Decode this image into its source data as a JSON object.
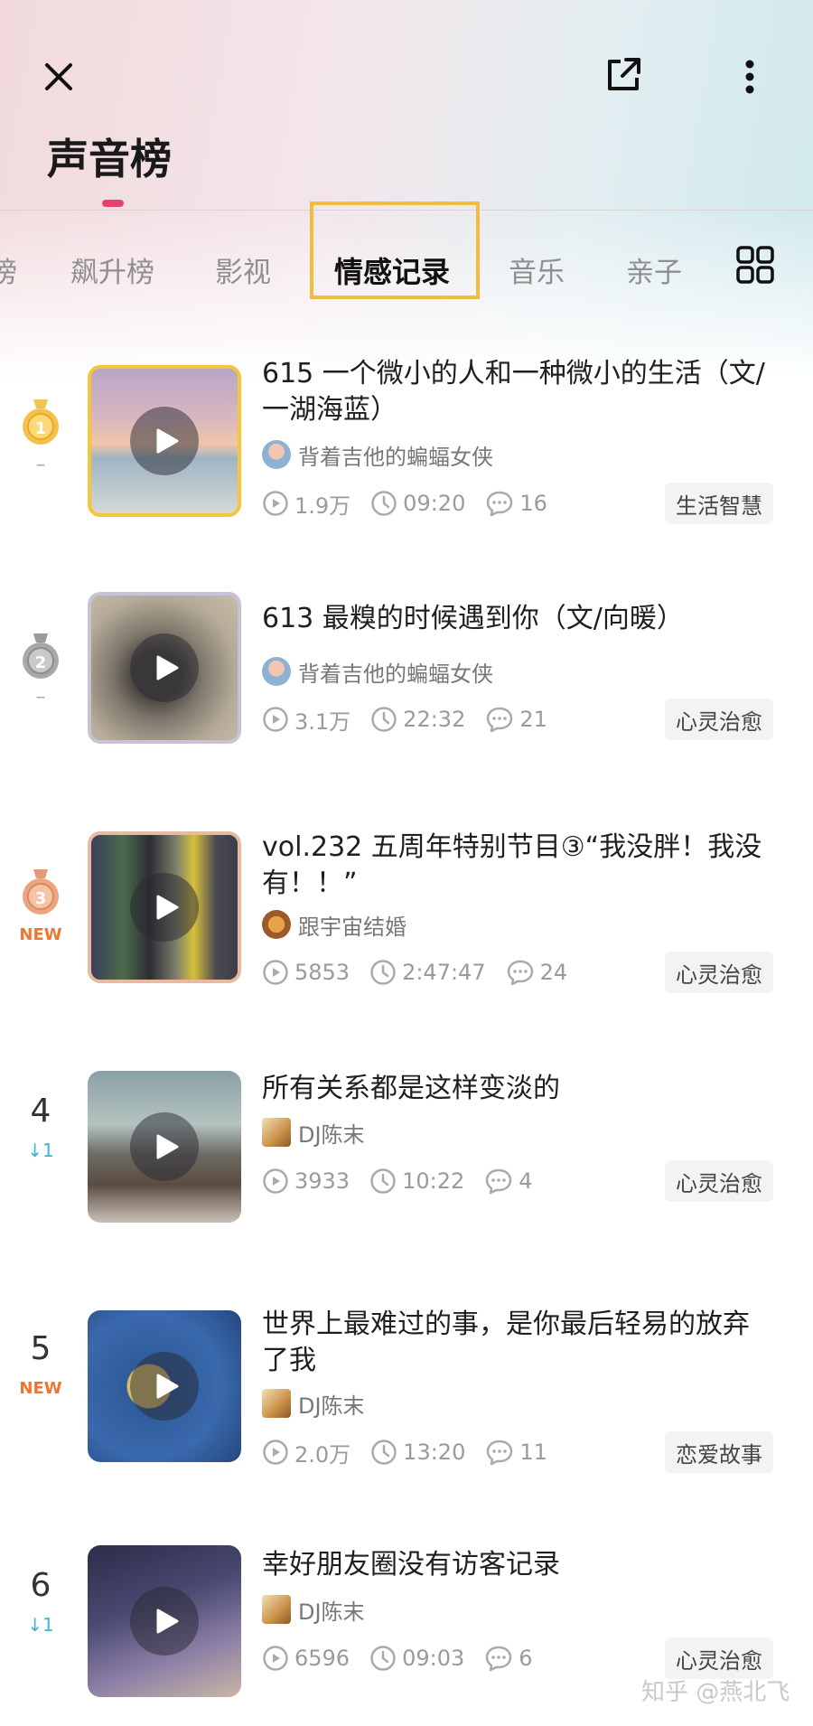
{
  "header": {
    "title": "声音榜"
  },
  "tabs": [
    {
      "label": "榜",
      "active": false
    },
    {
      "label": "飙升榜",
      "active": false
    },
    {
      "label": "影视",
      "active": false
    },
    {
      "label": "情感记录",
      "active": true
    },
    {
      "label": "音乐",
      "active": false
    },
    {
      "label": "亲子",
      "active": false
    }
  ],
  "items": [
    {
      "rank": "1",
      "rank_change": "–",
      "medal": "gold",
      "title": "615 一个微小的人和一种微小的生活（文/一湖海蓝）",
      "author": "背着吉他的蝙蝠女侠",
      "plays": "1.9万",
      "duration": "09:20",
      "comments": "16",
      "tag": "生活智慧"
    },
    {
      "rank": "2",
      "rank_change": "–",
      "medal": "silver",
      "title": "613 最糗的时候遇到你（文/向暖）",
      "author": "背着吉他的蝙蝠女侠",
      "plays": "3.1万",
      "duration": "22:32",
      "comments": "21",
      "tag": "心灵治愈"
    },
    {
      "rank": "3",
      "rank_change": "NEW",
      "medal": "bronze",
      "title": "vol.232 五周年特别节目③“我没胖！我没有！！”",
      "author": "跟宇宙结婚",
      "plays": "5853",
      "duration": "2:47:47",
      "comments": "24",
      "tag": "心灵治愈"
    },
    {
      "rank": "4",
      "rank_change": "↓1",
      "title": "所有关系都是这样变淡的",
      "author": "DJ陈末",
      "plays": "3933",
      "duration": "10:22",
      "comments": "4",
      "tag": "心灵治愈"
    },
    {
      "rank": "5",
      "rank_change": "NEW",
      "title": "世界上最难过的事，是你最后轻易的放弃了我",
      "author": "DJ陈末",
      "plays": "2.0万",
      "duration": "13:20",
      "comments": "11",
      "tag": "恋爱故事"
    },
    {
      "rank": "6",
      "rank_change": "↓1",
      "title": "幸好朋友圈没有访客记录",
      "author": "DJ陈末",
      "plays": "6596",
      "duration": "09:03",
      "comments": "6",
      "tag": "心灵治愈"
    }
  ],
  "watermark": "知乎 @燕北飞",
  "colors": {
    "accent": "#e8416b",
    "tab_highlight": "#f2bc3e",
    "new_badge": "#f0752e",
    "down_arrow": "#3cb3d6"
  }
}
